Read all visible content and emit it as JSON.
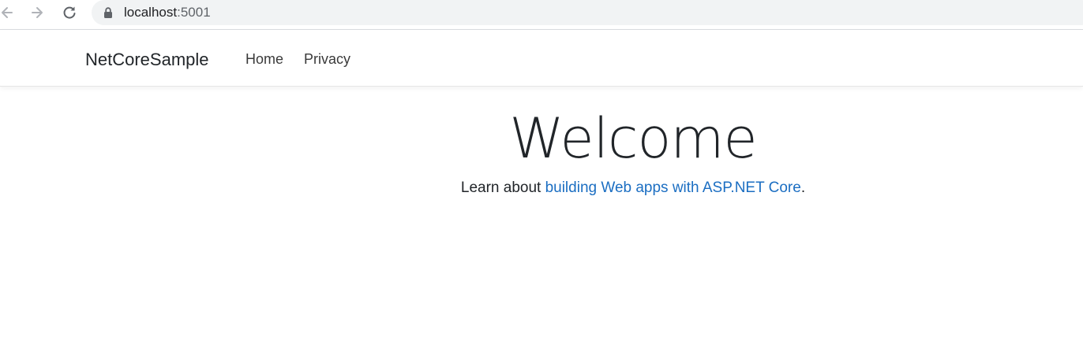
{
  "browser": {
    "url_host": "localhost",
    "url_port": ":5001",
    "icons": [
      "back-arrow-icon",
      "forward-arrow-icon",
      "reload-icon",
      "lock-icon"
    ]
  },
  "navbar": {
    "brand": "NetCoreSample",
    "links": [
      {
        "label": "Home"
      },
      {
        "label": "Privacy"
      }
    ]
  },
  "main": {
    "title": "Welcome",
    "lead_prefix": "Learn about ",
    "lead_link": "building Web apps with ASP.NET Core",
    "lead_suffix": "."
  },
  "colors": {
    "link": "#1b6ec2",
    "text": "#212529",
    "omnibox": "#f1f3f4"
  }
}
